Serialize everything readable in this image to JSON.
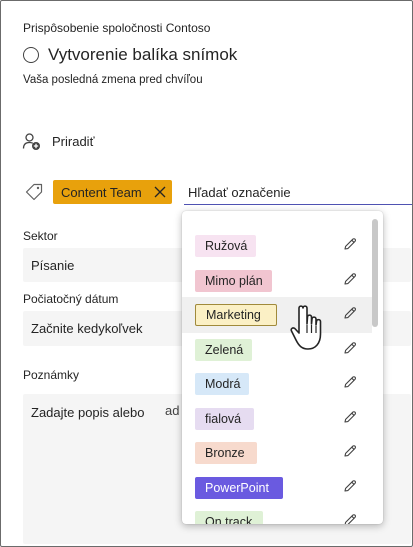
{
  "header": {
    "app_name": "Prispôsobenie spoločnosti Contoso",
    "task_title": "Vytvorenie balíka snímok",
    "last_change": "Vaša posledná zmena pred chvíľou"
  },
  "assign": {
    "label": "Priradiť",
    "icon": "add-person-icon"
  },
  "tags": {
    "icon": "tag-icon",
    "selected": {
      "label": "Content Team",
      "color": "#e8a10c"
    },
    "search_placeholder": "Hľadať označenie"
  },
  "fields": {
    "sector_label": "Sektor",
    "sector_value": "Písanie",
    "start_date_label": "Počiatočný dátum",
    "start_date_value": "Začnite kedykoľvek",
    "notes_label": "Poznámky",
    "notes_placeholder": "Zadajte popis alebo",
    "notes_trailing": "ad"
  },
  "dropdown": {
    "options": [
      {
        "label": "Ružová",
        "bg": "#f7e3f1",
        "fg": "#242424"
      },
      {
        "label": "Mimo plán",
        "bg": "#f1c5d0",
        "fg": "#242424"
      },
      {
        "label": "Marketing",
        "bg": "#fbf0c5",
        "fg": "#242424",
        "border": "#a08a3b",
        "hovered": true
      },
      {
        "label": "Zelená",
        "bg": "#dff1d6",
        "fg": "#242424"
      },
      {
        "label": "Modrá",
        "bg": "#d6e8f8",
        "fg": "#242424"
      },
      {
        "label": "fialová",
        "bg": "#e6dcf1",
        "fg": "#242424"
      },
      {
        "label": "Bronze",
        "bg": "#f7dacd",
        "fg": "#242424"
      },
      {
        "label": "PowerPoint",
        "bg": "#6a5ae0",
        "fg": "#ffffff"
      },
      {
        "label": "On track",
        "bg": "#dff1d6",
        "fg": "#242424"
      }
    ],
    "edit_icon": "pencil-icon",
    "scroll_position": 0.0
  },
  "cursor_icon": "hand-pointer-icon"
}
